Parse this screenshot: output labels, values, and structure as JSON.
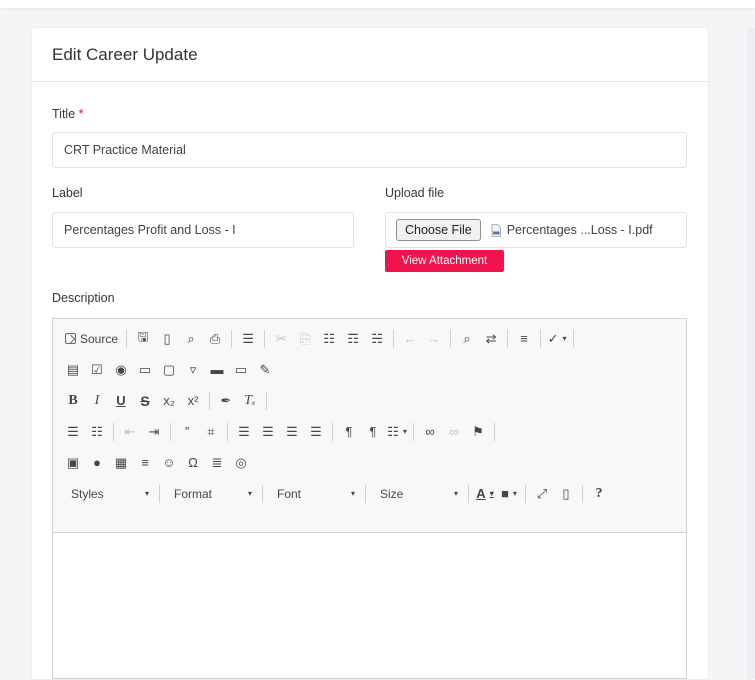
{
  "card": {
    "title": "Edit Career Update"
  },
  "form": {
    "title_label": "Title",
    "required_mark": "*",
    "title_value": "CRT Practice Material",
    "label_label": "Label",
    "label_value": "Percentages Profit and Loss - I",
    "upload_label": "Upload file",
    "choose_file": "Choose File",
    "file_name": "Percentages ...Loss - I.pdf",
    "view_attachment": "View Attachment",
    "description_label": "Description"
  },
  "toolbar": {
    "source": "Source",
    "styles": "Styles",
    "format": "Format",
    "font": "Font",
    "size": "Size"
  },
  "colors": {
    "accent": "#f0134d",
    "required": "#e4003a"
  }
}
